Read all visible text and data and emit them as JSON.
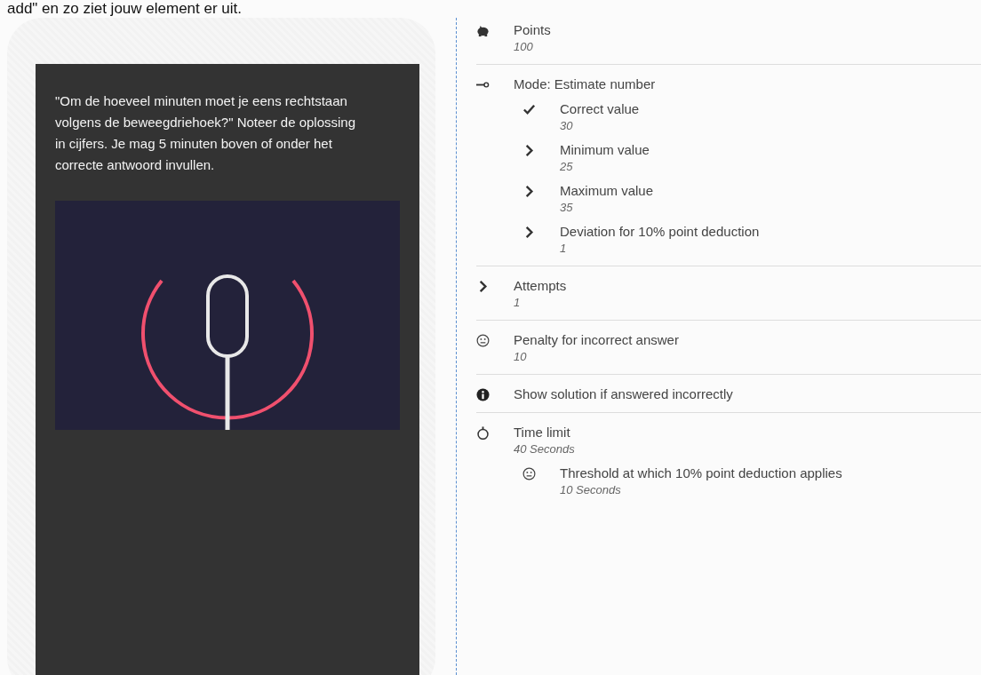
{
  "caption": "add\" en zo ziet jouw element er uit.",
  "preview": {
    "question": "\"Om de hoeveel minuten moet je eens rechtstaan volgens de beweegdriehoek?\" Noteer de oplossing in cijfers. Je mag 5 minuten boven of onder het correcte antwoord invullen."
  },
  "settings": [
    {
      "kind": "points",
      "label": "Points",
      "value": "100"
    },
    {
      "kind": "mode",
      "label": "Mode: Estimate number",
      "children": [
        {
          "kind": "check",
          "label": "Correct value",
          "value": "30"
        },
        {
          "kind": "chevron",
          "label": "Minimum value",
          "value": "25"
        },
        {
          "kind": "chevron",
          "label": "Maximum value",
          "value": "35"
        },
        {
          "kind": "chevron",
          "label": "Deviation for 10% point deduction",
          "value": "1"
        }
      ]
    },
    {
      "kind": "chevron",
      "label": "Attempts",
      "value": "1"
    },
    {
      "kind": "face",
      "label": "Penalty for incorrect answer",
      "value": "10"
    },
    {
      "kind": "info",
      "label": "Show solution if answered incorrectly"
    },
    {
      "kind": "timer",
      "label": "Time limit",
      "value": "40 Seconds",
      "children": [
        {
          "kind": "face",
          "label": "Threshold at which 10% point deduction applies",
          "value": "10 Seconds"
        }
      ]
    }
  ]
}
